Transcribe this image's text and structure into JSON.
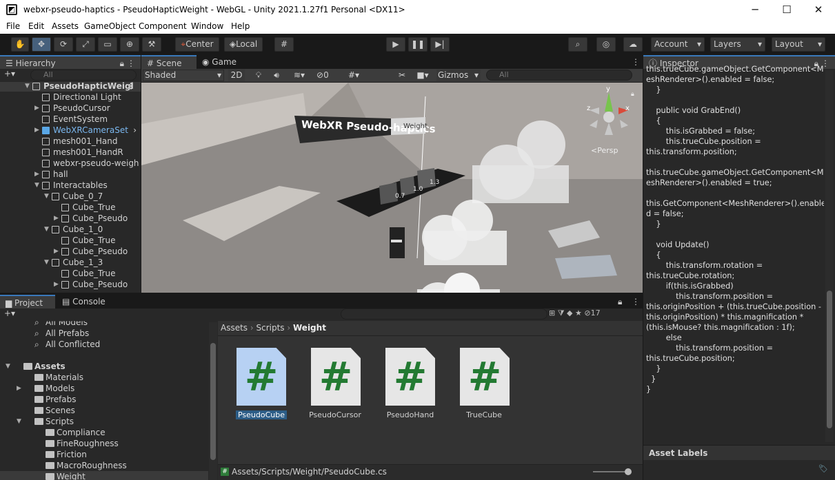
{
  "window": {
    "title": "webxr-pseudo-haptics - PseudoHapticWeight - WebGL - Unity 2021.1.27f1 Personal <DX11>",
    "minimize": "─",
    "maximize": "☐",
    "close": "✕"
  },
  "menu": [
    "File",
    "Edit",
    "Assets",
    "GameObject",
    "Component",
    "Window",
    "Help"
  ],
  "toolbar": {
    "pivot": "Center",
    "space": "Local",
    "account": "Account",
    "layers": "Layers",
    "layout": "Layout"
  },
  "hierarchy": {
    "tab": "Hierarchy",
    "search_placeholder": "All",
    "items": [
      {
        "label": "PseudoHapticWeigl",
        "depth": 0,
        "arrow": "▼",
        "scene": true
      },
      {
        "label": "Directional Light",
        "depth": 1,
        "arrow": ""
      },
      {
        "label": "PseudoCursor",
        "depth": 1,
        "arrow": "▶"
      },
      {
        "label": "EventSystem",
        "depth": 1,
        "arrow": ""
      },
      {
        "label": "WebXRCameraSet",
        "depth": 1,
        "arrow": "▶",
        "prefab": true
      },
      {
        "label": "mesh001_Hand",
        "depth": 1,
        "arrow": ""
      },
      {
        "label": "mesh001_HandR",
        "depth": 1,
        "arrow": ""
      },
      {
        "label": "webxr-pseudo-weigh",
        "depth": 1,
        "arrow": ""
      },
      {
        "label": "hall",
        "depth": 1,
        "arrow": "▶"
      },
      {
        "label": "Interactables",
        "depth": 1,
        "arrow": "▼"
      },
      {
        "label": "Cube_0_7",
        "depth": 2,
        "arrow": "▼"
      },
      {
        "label": "Cube_True",
        "depth": 3,
        "arrow": ""
      },
      {
        "label": "Cube_Pseudo",
        "depth": 3,
        "arrow": "▶"
      },
      {
        "label": "Cube_1_0",
        "depth": 2,
        "arrow": "▼"
      },
      {
        "label": "Cube_True",
        "depth": 3,
        "arrow": ""
      },
      {
        "label": "Cube_Pseudo",
        "depth": 3,
        "arrow": "▶"
      },
      {
        "label": "Cube_1_3",
        "depth": 2,
        "arrow": "▼"
      },
      {
        "label": "Cube_True",
        "depth": 3,
        "arrow": ""
      },
      {
        "label": "Cube_Pseudo",
        "depth": 3,
        "arrow": "▶"
      }
    ]
  },
  "scene": {
    "tab_scene": "Scene",
    "tab_game": "Game",
    "shading": "Shaded",
    "mode2d": "2D",
    "hidden_count": "0",
    "gizmos": "Gizmos",
    "search_placeholder": "All",
    "persp": "Persp",
    "axis_x": "x",
    "axis_y": "y",
    "axis_z": "z",
    "banner_main": "WebXR Pseudo-haptics",
    "banner_side": "Weight",
    "cube_labels": [
      "0.7",
      "1.0",
      "1.3"
    ]
  },
  "inspector": {
    "tab": "Inspector",
    "asset_labels": "Asset Labels",
    "code": "this.trueCube.gameObject.GetComponent<M\neshRenderer>().enabled = false;\n    }\n\n    public void GrabEnd()\n    {\n        this.isGrabbed = false;\n        this.trueCube.position =\nthis.transform.position;\n\nthis.trueCube.gameObject.GetComponent<M\neshRenderer>().enabled = true;\n\nthis.GetComponent<MeshRenderer>().enable\nd = false;\n    }\n\n    void Update()\n    {\n        this.transform.rotation =\nthis.trueCube.rotation;\n        if(this.isGrabbed)\n            this.transform.position =\nthis.originPosition + (this.trueCube.position -\nthis.originPosition) * this.magnification *\n(this.isMouse? this.magnification : 1f);\n        else\n            this.transform.position =\nthis.trueCube.position;\n    }\n  }\n}"
  },
  "project": {
    "tab_project": "Project",
    "tab_console": "Console",
    "hidden_count": "17",
    "tree": [
      {
        "label": "All Models",
        "depth": 1,
        "kind": "search",
        "partial": true
      },
      {
        "label": "All Prefabs",
        "depth": 1,
        "kind": "search"
      },
      {
        "label": "All Conflicted",
        "depth": 1,
        "kind": "search"
      },
      {
        "label": "",
        "depth": 0,
        "kind": "gap"
      },
      {
        "label": "Assets",
        "depth": 0,
        "kind": "folder",
        "arrow": "▼",
        "bold": true
      },
      {
        "label": "Materials",
        "depth": 1,
        "kind": "folder"
      },
      {
        "label": "Models",
        "depth": 1,
        "kind": "folder",
        "arrow": "▶"
      },
      {
        "label": "Prefabs",
        "depth": 1,
        "kind": "folder"
      },
      {
        "label": "Scenes",
        "depth": 1,
        "kind": "folder"
      },
      {
        "label": "Scripts",
        "depth": 1,
        "kind": "folder",
        "arrow": "▼"
      },
      {
        "label": "Compliance",
        "depth": 2,
        "kind": "folder"
      },
      {
        "label": "FineRoughness",
        "depth": 2,
        "kind": "folder"
      },
      {
        "label": "Friction",
        "depth": 2,
        "kind": "folder"
      },
      {
        "label": "MacroRoughness",
        "depth": 2,
        "kind": "folder"
      },
      {
        "label": "Weight",
        "depth": 2,
        "kind": "folder",
        "selected": true
      }
    ],
    "breadcrumb": [
      "Assets",
      "Scripts",
      "Weight"
    ],
    "files": [
      {
        "label": "PseudoCube",
        "selected": true
      },
      {
        "label": "PseudoCursor"
      },
      {
        "label": "PseudoHand"
      },
      {
        "label": "TrueCube"
      }
    ],
    "hash": "#",
    "path": "Assets/Scripts/Weight/PseudoCube.cs"
  }
}
